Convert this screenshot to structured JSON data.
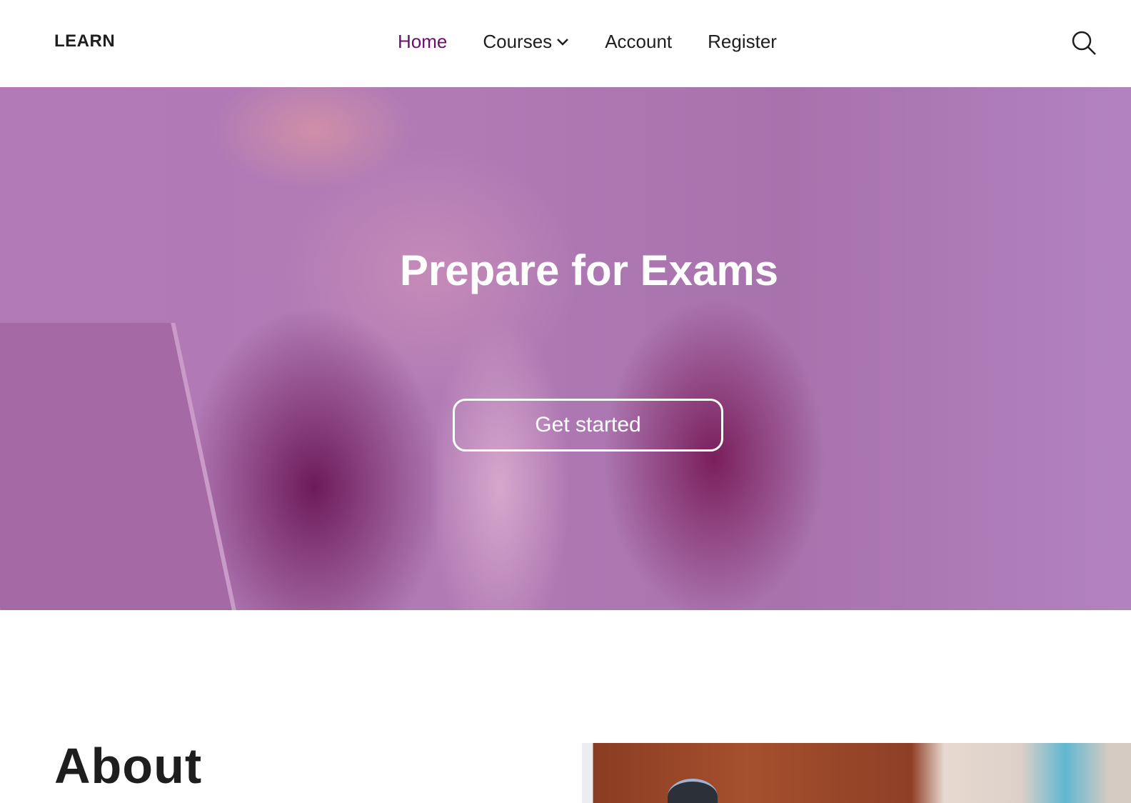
{
  "nav": {
    "logo": "LEARN",
    "items": [
      {
        "label": "Home",
        "active": true
      },
      {
        "label": "Courses",
        "has_dropdown": true
      },
      {
        "label": "Account"
      },
      {
        "label": "Register"
      }
    ],
    "search_icon": "search-icon"
  },
  "hero": {
    "title": "Prepare for Exams",
    "button_label": "Get started"
  },
  "about": {
    "heading": "About"
  },
  "colors": {
    "accent": "#6a0f6e",
    "hero_overlay": "#b07bb5"
  }
}
